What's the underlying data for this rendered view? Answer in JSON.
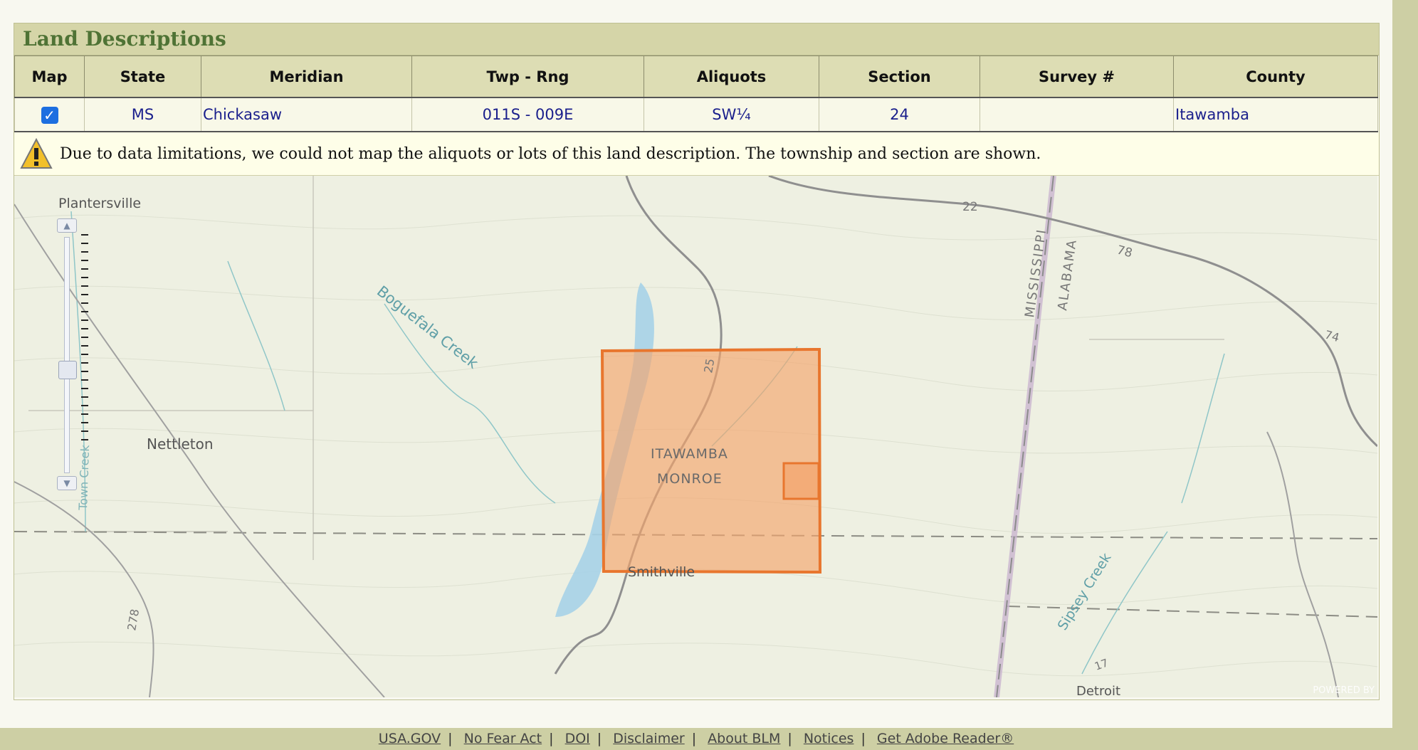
{
  "panel": {
    "title": "Land Descriptions"
  },
  "table": {
    "headers": [
      "Map",
      "State",
      "Meridian",
      "Twp - Rng",
      "Aliquots",
      "Section",
      "Survey #",
      "County"
    ],
    "rows": [
      {
        "map_checked": true,
        "state": "MS",
        "meridian": "Chickasaw",
        "twp_rng": "011S - 009E",
        "aliquots": "SW¼",
        "section": "24",
        "survey": "",
        "county": "Itawamba"
      }
    ]
  },
  "warning": {
    "icon": "warning-triangle-icon",
    "text": "Due to data limitations, we could not map the aliquots or lots of this land description. The township and section are shown."
  },
  "map": {
    "labels": {
      "plantersville": "Plantersville",
      "nettleton": "Nettleton",
      "smithville": "Smithville",
      "boguefala": "Boguefala Creek",
      "itawamba": "ITAWAMBA",
      "monroe": "MONROE",
      "mississippi": "MISSISSIPPI",
      "alabama": "ALABAMA",
      "sipsey": "Sipsey Creek",
      "detroit": "Detroit",
      "town_creek": "Town Creek",
      "r22": "22",
      "r78": "78",
      "r74": "74",
      "r25": "25",
      "r278": "278",
      "r17": "17"
    },
    "powered_by": "POWERED BY",
    "township_color": "#f4a46c",
    "township_border": "#e8762e"
  },
  "footer": {
    "links": [
      "USA.GOV",
      "No Fear Act",
      "DOI",
      "Disclaimer",
      "About BLM",
      "Notices",
      "Get Adobe Reader®"
    ]
  }
}
